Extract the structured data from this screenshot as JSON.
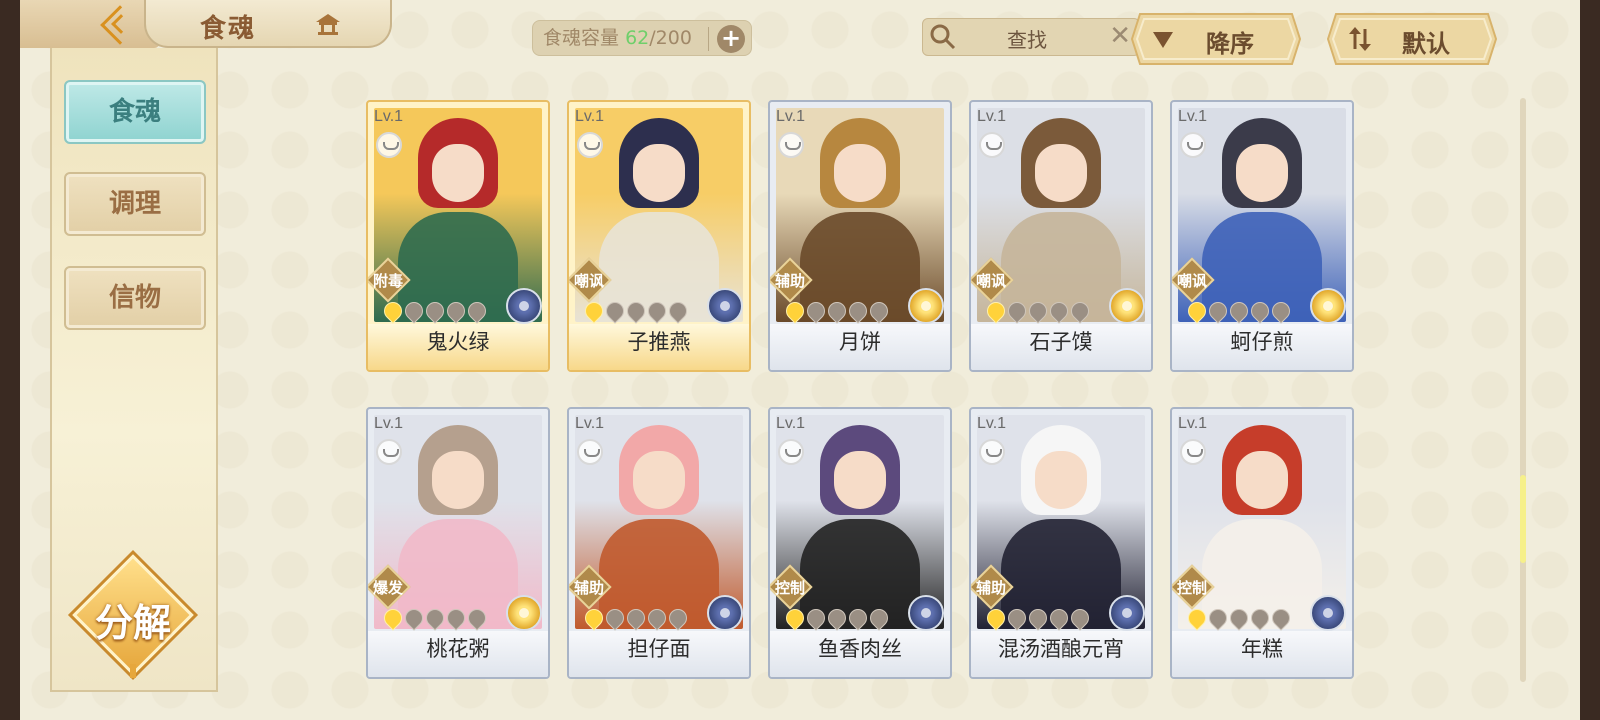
{
  "header": {
    "title": "食魂",
    "capacity_label": "食魂容量",
    "capacity_current": "62",
    "capacity_max": "/200",
    "capacity_add": "+",
    "search_placeholder": "查找",
    "search_clear": "✕",
    "sort_order_label": "降序",
    "sort_mode_label": "默认"
  },
  "sidebar": {
    "items": [
      {
        "label": "食魂",
        "active": true
      },
      {
        "label": "调理",
        "active": false
      },
      {
        "label": "信物",
        "active": false
      }
    ],
    "decompose_label": "分解"
  },
  "cards": [
    {
      "level": "Lv.1",
      "role": "附毒",
      "name": "鬼火绿",
      "stars": 1,
      "element": "blue",
      "rarity": "gold",
      "palette": [
        "#f5c85a",
        "#b52a2a",
        "#2f6b4f"
      ]
    },
    {
      "level": "Lv.1",
      "role": "嘲讽",
      "name": "子推燕",
      "stars": 1,
      "element": "blue",
      "rarity": "gold",
      "palette": [
        "#f7cd66",
        "#2d2f4e",
        "#e8e3d6"
      ]
    },
    {
      "level": "Lv.1",
      "role": "辅助",
      "name": "月饼",
      "stars": 1,
      "element": "gold",
      "rarity": "silver",
      "palette": [
        "#e8d9b8",
        "#b7873f",
        "#6a4a2a"
      ]
    },
    {
      "level": "Lv.1",
      "role": "嘲讽",
      "name": "石子馍",
      "stars": 1,
      "element": "gold",
      "rarity": "silver",
      "palette": [
        "#dcdfe6",
        "#7b5a3a",
        "#c5b59a"
      ]
    },
    {
      "level": "Lv.1",
      "role": "嘲讽",
      "name": "蚵仔煎",
      "stars": 1,
      "element": "gold",
      "rarity": "silver",
      "palette": [
        "#d9dde6",
        "#3b3b4a",
        "#3e62b8"
      ]
    },
    {
      "level": "Lv.1",
      "role": "爆发",
      "name": "桃花粥",
      "stars": 1,
      "element": "gold",
      "rarity": "silver",
      "palette": [
        "#dfe2ea",
        "#b5a08e",
        "#f1b9c9"
      ]
    },
    {
      "level": "Lv.1",
      "role": "辅助",
      "name": "担仔面",
      "stars": 1,
      "element": "blue",
      "rarity": "silver",
      "palette": [
        "#dfe2ea",
        "#f2a8a8",
        "#c05a2d"
      ]
    },
    {
      "level": "Lv.1",
      "role": "控制",
      "name": "鱼香肉丝",
      "stars": 1,
      "element": "blue",
      "rarity": "silver",
      "palette": [
        "#dfe2ea",
        "#5c4a7d",
        "#222222"
      ]
    },
    {
      "level": "Lv.1",
      "role": "辅助",
      "name": "混汤酒酿元宵",
      "stars": 1,
      "element": "blue",
      "rarity": "silver",
      "palette": [
        "#dfe2ea",
        "#f6f6f6",
        "#222233"
      ]
    },
    {
      "level": "Lv.1",
      "role": "控制",
      "name": "年糕",
      "stars": 1,
      "element": "blue",
      "rarity": "silver",
      "palette": [
        "#dfe2ea",
        "#c63d2a",
        "#f4f0ea"
      ]
    }
  ],
  "scroll_position": 0.76
}
